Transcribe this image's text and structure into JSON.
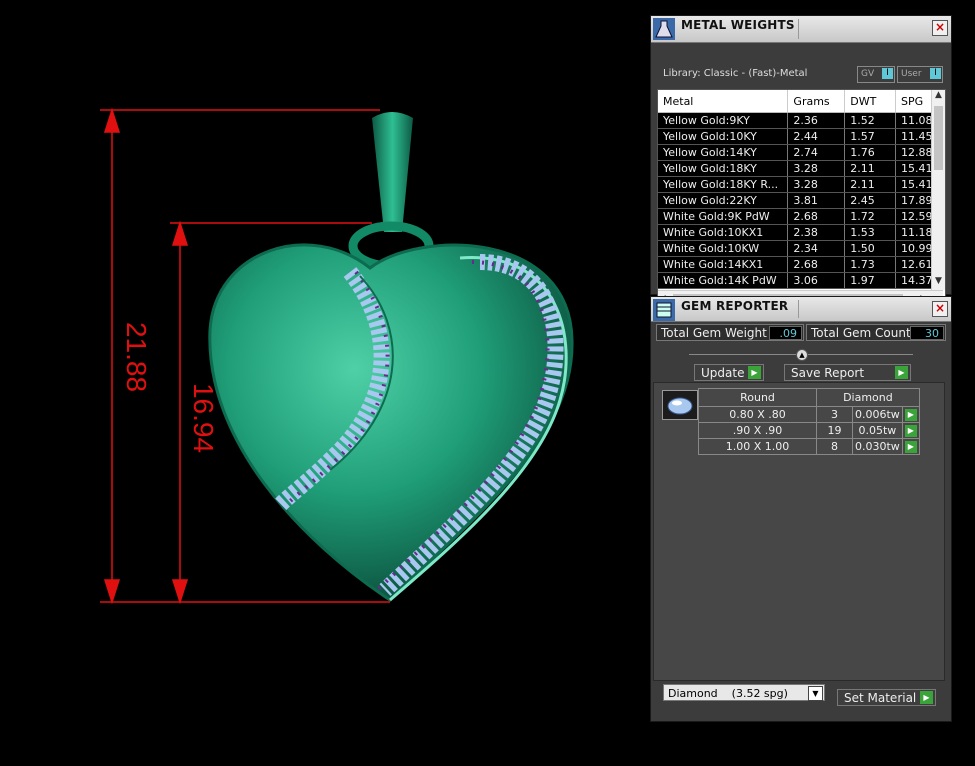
{
  "dimensions": {
    "overall": "21.88",
    "inner": "16.94",
    "color": "#e01010"
  },
  "metal_weights": {
    "title": "METAL WEIGHTS",
    "library": "Library: Classic - (Fast)-Metal",
    "toggle_gv": "GV",
    "toggle_user": "User",
    "toggle_knob": "I",
    "columns": [
      "Metal",
      "Grams",
      "DWT",
      "SPG"
    ],
    "rows": [
      [
        "Yellow Gold:9KY",
        "2.36",
        "1.52",
        "11.08"
      ],
      [
        "Yellow Gold:10KY",
        "2.44",
        "1.57",
        "11.45"
      ],
      [
        "Yellow Gold:14KY",
        "2.74",
        "1.76",
        "12.88"
      ],
      [
        "Yellow Gold:18KY",
        "3.28",
        "2.11",
        "15.41"
      ],
      [
        "Yellow Gold:18KY R...",
        "3.28",
        "2.11",
        "15.41"
      ],
      [
        "Yellow Gold:22KY",
        "3.81",
        "2.45",
        "17.89"
      ],
      [
        "White Gold:9K PdW",
        "2.68",
        "1.72",
        "12.59"
      ],
      [
        "White Gold:10KX1",
        "2.38",
        "1.53",
        "11.18"
      ],
      [
        "White Gold:10KW",
        "2.34",
        "1.50",
        "10.99"
      ],
      [
        "White Gold:14KX1",
        "2.68",
        "1.73",
        "12.61"
      ],
      [
        "White Gold:14K PdW",
        "3.06",
        "1.97",
        "14.37"
      ]
    ]
  },
  "gem_reporter": {
    "title": "GEM REPORTER",
    "total_weight_label": "Total Gem Weight",
    "total_weight_value": ".09",
    "total_count_label": "Total Gem Count",
    "total_count_value": "30",
    "update_label": "Update",
    "save_report_label": "Save Report",
    "shape_header": "Round",
    "material_header": "Diamond",
    "gems": [
      [
        "0.80 X .80",
        "3",
        "0.006tw"
      ],
      [
        ".90 X .90",
        "19",
        "0.05tw"
      ],
      [
        "1.00 X 1.00",
        "8",
        "0.030tw"
      ]
    ],
    "material_select": "Diamond    (3.52 spg)",
    "set_material_label": "Set Material"
  },
  "colors": {
    "metal": "#1f9e78",
    "gem_light": "#a8c8f0",
    "gem_dark": "#6a2a8c"
  }
}
